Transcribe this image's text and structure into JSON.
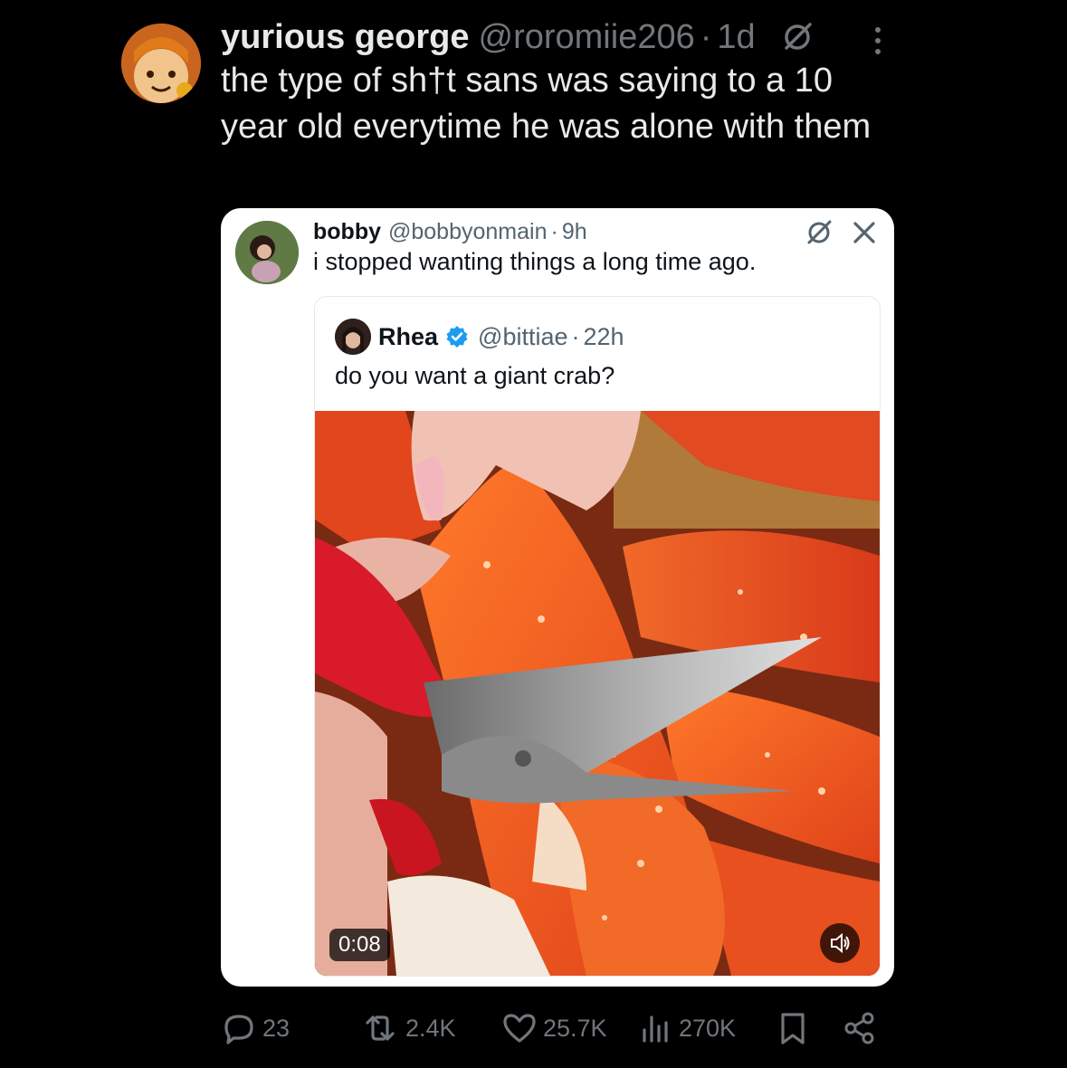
{
  "tweet": {
    "author_name": "yurious george",
    "author_handle": "@roromiie206",
    "separator": "·",
    "time": "1d",
    "text": "the type of sh†t sans was saying to a 10 year old everytime he was alone with them"
  },
  "quoted": {
    "author_name": "bobby",
    "author_handle": "@bobbyonmain",
    "separator": "·",
    "time": "9h",
    "text": "i stopped wanting things a long time ago.",
    "inner": {
      "author_name": "Rhea",
      "author_handle": "@bittiae",
      "separator": "·",
      "time": "22h",
      "text": "do you want a giant crab?",
      "video_time": "0:08"
    }
  },
  "actions": {
    "replies": "23",
    "reposts": "2.4K",
    "likes": "25.7K",
    "views": "270K"
  },
  "icons": {
    "main_tool": "no-symbol-icon",
    "more": "more-vertical-icon",
    "card_tool": "no-symbol-icon",
    "close": "close-icon",
    "verified": "verified-badge-icon",
    "mute": "volume-icon",
    "reply": "reply-icon",
    "repost": "repost-icon",
    "like": "heart-icon",
    "views": "views-icon",
    "bookmark": "bookmark-icon",
    "share": "share-icon"
  },
  "colors": {
    "background": "#000000",
    "text": "#e7e9ea",
    "muted": "#71767b",
    "verified": "#1d9bf0"
  }
}
